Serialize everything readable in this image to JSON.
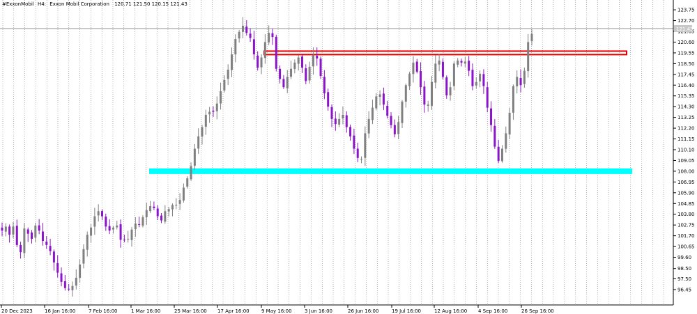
{
  "header": {
    "symbol": "#ExxonMobil",
    "timeframe": "H4:",
    "description": "Exxon Mobil Corporation",
    "ohlc": "120.71 121.50 120.15 121.43"
  },
  "current_price": "121.43",
  "colors": {
    "bull_candle": "#808080",
    "bear_candle": "#8a14c8",
    "resistance_zone": "#e00000",
    "support_zone": "#00ffff",
    "grid": "#000000",
    "price_line": "#c8c8c8"
  },
  "chart_data": {
    "type": "candlestick",
    "title": "",
    "ylim": [
      95.9,
      124.3
    ],
    "y_ticks": [
      "123.75",
      "122.70",
      "121.65",
      "120.60",
      "119.55",
      "118.50",
      "117.45",
      "116.40",
      "115.35",
      "114.30",
      "113.25",
      "112.20",
      "111.15",
      "110.10",
      "109.05",
      "108.00",
      "106.95",
      "105.90",
      "104.85",
      "103.80",
      "102.75",
      "101.70",
      "100.65",
      "99.60",
      "98.50",
      "97.50",
      "96.45"
    ],
    "x_ticks": [
      "20 Dec 2023",
      "16 Jan 16:00",
      "7 Feb 16:00",
      "1 Mar 16:00",
      "25 Mar 16:00",
      "17 Apr 16:00",
      "9 May 16:00",
      "3 Jun 16:00",
      "26 Jun 16:00",
      "19 Jul 16:00",
      "12 Aug 16:00",
      "4 Sep 16:00",
      "26 Sep 16:00"
    ],
    "approx_closes": [
      102.2,
      102.6,
      101.8,
      102.6,
      100.8,
      100.1,
      102.4,
      101.9,
      101.4,
      102.7,
      102.2,
      101.2,
      100.8,
      100.2,
      99.1,
      98.1,
      97.2,
      96.6,
      96.5,
      96.8,
      97.6,
      98.9,
      100.4,
      101.8,
      102.5,
      103.6,
      104.1,
      103.6,
      102.6,
      102.2,
      102.5,
      102.7,
      101.3,
      101.3,
      101.4,
      102.3,
      102.9,
      102.8,
      103.5,
      104.2,
      104.6,
      104.4,
      103.6,
      103.2,
      104.1,
      104.3,
      104.7,
      104.7,
      105.2,
      106.4,
      107.3,
      108.5,
      110.2,
      111.4,
      112.3,
      113.5,
      113.8,
      113.8,
      114.6,
      115.8,
      116.9,
      117.9,
      119.4,
      120.9,
      121.6,
      122.2,
      121.5,
      121.0,
      119.4,
      118.1,
      119.1,
      120.6,
      121.5,
      121.1,
      118.0,
      117.0,
      116.2,
      117.2,
      118.0,
      118.6,
      119.1,
      118.1,
      116.8,
      118.2,
      119.3,
      119.0,
      117.3,
      115.6,
      114.3,
      113.1,
      112.6,
      113.1,
      113.5,
      112.3,
      111.4,
      110.2,
      109.3,
      109.2,
      111.7,
      113.1,
      114.2,
      115.3,
      115.5,
      114.5,
      113.4,
      112.5,
      111.6,
      112.8,
      114.8,
      116.4,
      117.5,
      118.6,
      117.7,
      116.2,
      114.5,
      114.5,
      116.7,
      118.5,
      118.8,
      117.2,
      115.4,
      116.2,
      118.5,
      118.8,
      118.6,
      118.7,
      117.8,
      116.3,
      116.7,
      117.5,
      116.3,
      114.2,
      112.5,
      110.4,
      109.0,
      110.2,
      111.7,
      113.7,
      116.3,
      117.2,
      116.4,
      117.8,
      120.6,
      121.4
    ]
  },
  "levels": {
    "resistance": 119.55,
    "support": 108.0
  }
}
